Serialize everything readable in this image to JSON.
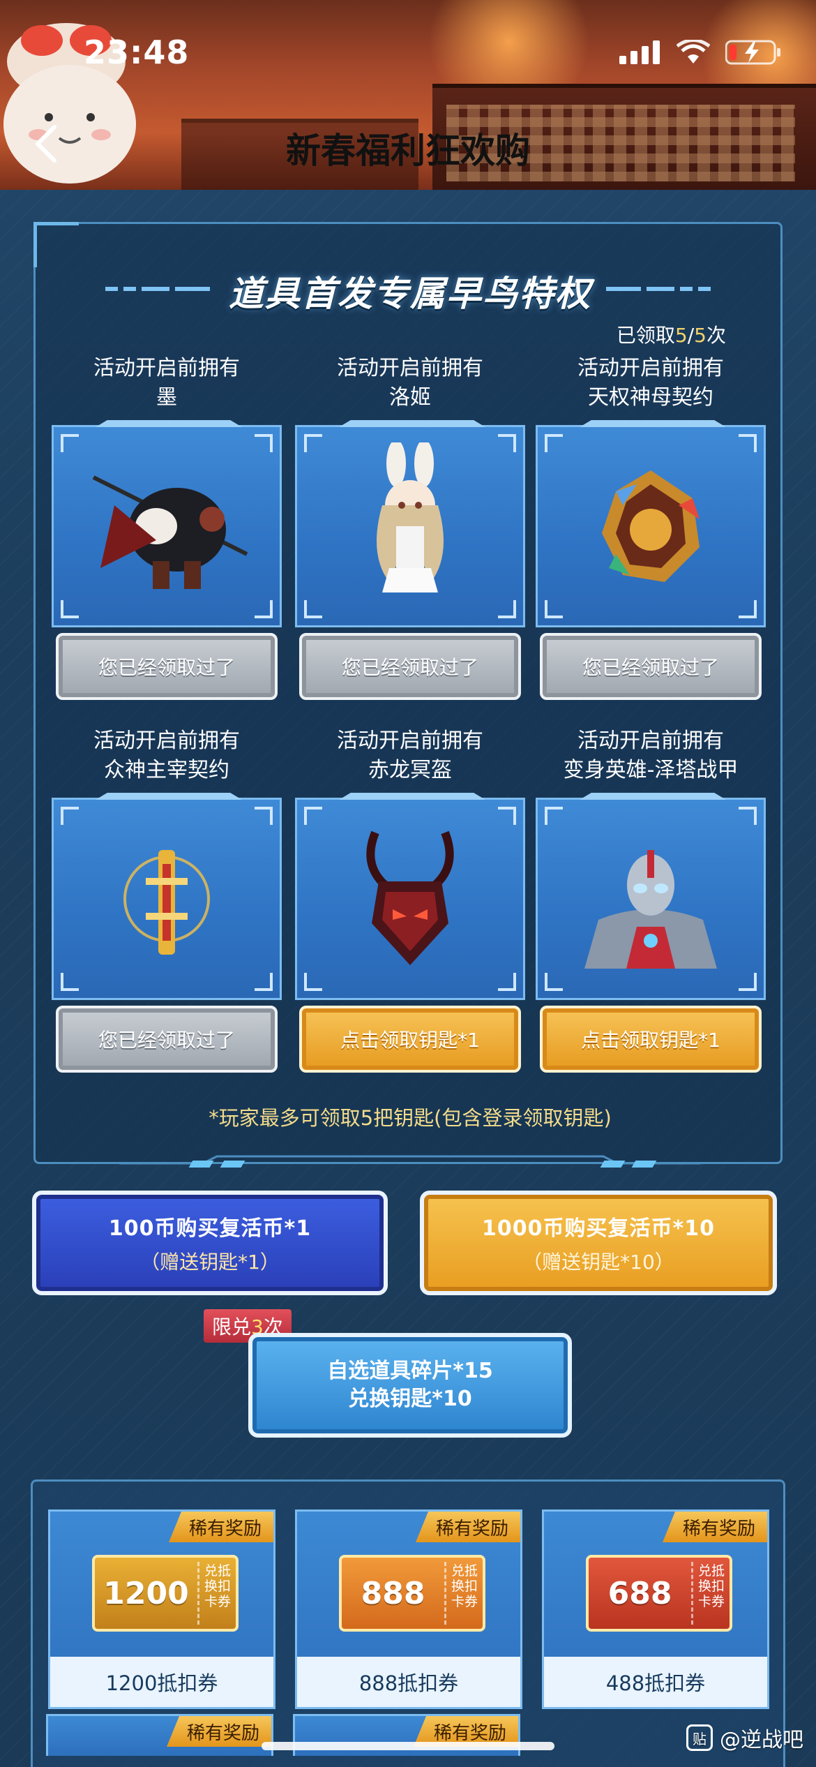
{
  "status": {
    "time": "23:48"
  },
  "header": {
    "title": "新春福利狂欢购"
  },
  "panel": {
    "title": "道具首发专属早鸟特权",
    "claimed_prefix": "已领取",
    "claimed_count": "5",
    "claimed_sep": "/",
    "claimed_total": "5",
    "claimed_suffix": "次",
    "items": [
      {
        "line1": "活动开启前拥有",
        "line2": "墨",
        "button": "您已经领取过了",
        "state": "claimed"
      },
      {
        "line1": "活动开启前拥有",
        "line2": "洛姬",
        "button": "您已经领取过了",
        "state": "claimed"
      },
      {
        "line1": "活动开启前拥有",
        "line2": "天权神母契约",
        "button": "您已经领取过了",
        "state": "claimed"
      },
      {
        "line1": "活动开启前拥有",
        "line2": "众神主宰契约",
        "button": "您已经领取过了",
        "state": "claimed"
      },
      {
        "line1": "活动开启前拥有",
        "line2": "赤龙冥盔",
        "button": "点击领取钥匙*1",
        "state": "available"
      },
      {
        "line1": "活动开启前拥有",
        "line2": "变身英雄-泽塔战甲",
        "button": "点击领取钥匙*1",
        "state": "available"
      }
    ],
    "note": "*玩家最多可领取5把钥匙(包含登录领取钥匙)"
  },
  "purchase": {
    "blue": {
      "main": "100币购买复活币*1",
      "sub": "（赠送钥匙*1）"
    },
    "gold": {
      "main": "1000币购买复活币*10",
      "sub": "（赠送钥匙*10）"
    }
  },
  "exchange": {
    "limit_prefix": "限兑",
    "limit_count": "3",
    "limit_suffix": "次",
    "line1": "自选道具碎片*15",
    "line2": "兑换钥匙*10"
  },
  "rewards": {
    "rare_label": "稀有奖励",
    "coupon_tag": [
      "兑抵",
      "换扣",
      "卡券"
    ],
    "cards": [
      {
        "amount": "1200",
        "caption": "1200抵扣券",
        "style": "gold"
      },
      {
        "amount": "888",
        "caption": "888抵扣券",
        "style": "orange"
      },
      {
        "amount": "688",
        "caption": "488抵扣券",
        "style": "red"
      }
    ]
  },
  "watermark": {
    "logo": "贴",
    "text": "@逆战吧"
  },
  "colors": {
    "accent_gold": "#f3d26a",
    "panel_border": "#4d8ec0",
    "claimed_gray": "#aab0b7",
    "claim_gold": "#eea52a"
  }
}
